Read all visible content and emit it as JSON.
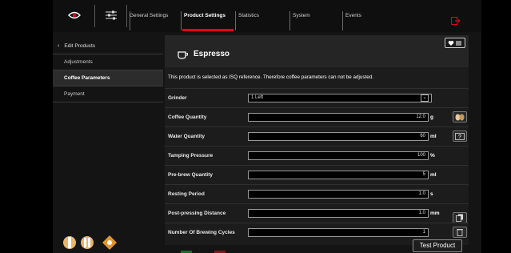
{
  "topbar": {
    "icons": [
      "eye-icon",
      "sliders-icon",
      "logout-icon"
    ],
    "tabs": [
      {
        "label": "General Settings",
        "active": false
      },
      {
        "label": "Product Settings",
        "active": true
      },
      {
        "label": "Statistics",
        "active": false
      },
      {
        "label": "System",
        "active": false
      },
      {
        "label": "Events",
        "active": false
      }
    ],
    "accent_color": "#e3001b"
  },
  "menu": {
    "items": [
      {
        "label": "Edit Products",
        "type": "back"
      },
      {
        "label": "Adjustments",
        "type": "normal"
      },
      {
        "label": "Coffee Parameters",
        "type": "active"
      },
      {
        "label": "Payment",
        "type": "normal"
      }
    ]
  },
  "product": {
    "name": "Espresso",
    "notice": "This product is selected as ISQ reference. Therefore coffee parameters can not be adjusted."
  },
  "params": [
    {
      "label": "Grinder",
      "value": "1 Left",
      "unit": "",
      "kind": "select"
    },
    {
      "label": "Coffee Quantity",
      "value": "12.0",
      "unit": "g",
      "kind": "number"
    },
    {
      "label": "Water Quantity",
      "value": "60",
      "unit": "ml",
      "kind": "number"
    },
    {
      "label": "Tamping Pressure",
      "value": "100",
      "unit": "%",
      "kind": "number"
    },
    {
      "label": "Pre-brew Quantity",
      "value": "5",
      "unit": "ml",
      "kind": "number"
    },
    {
      "label": "Resting Period",
      "value": "1.0",
      "unit": "s",
      "kind": "number"
    },
    {
      "label": "Post-pressing Distance",
      "value": "1.0",
      "unit": "mm",
      "kind": "number"
    },
    {
      "label": "Number Of Brewing Cycles",
      "value": "1",
      "unit": "",
      "kind": "number"
    }
  ],
  "actions": {
    "test_product": "Test Product"
  }
}
